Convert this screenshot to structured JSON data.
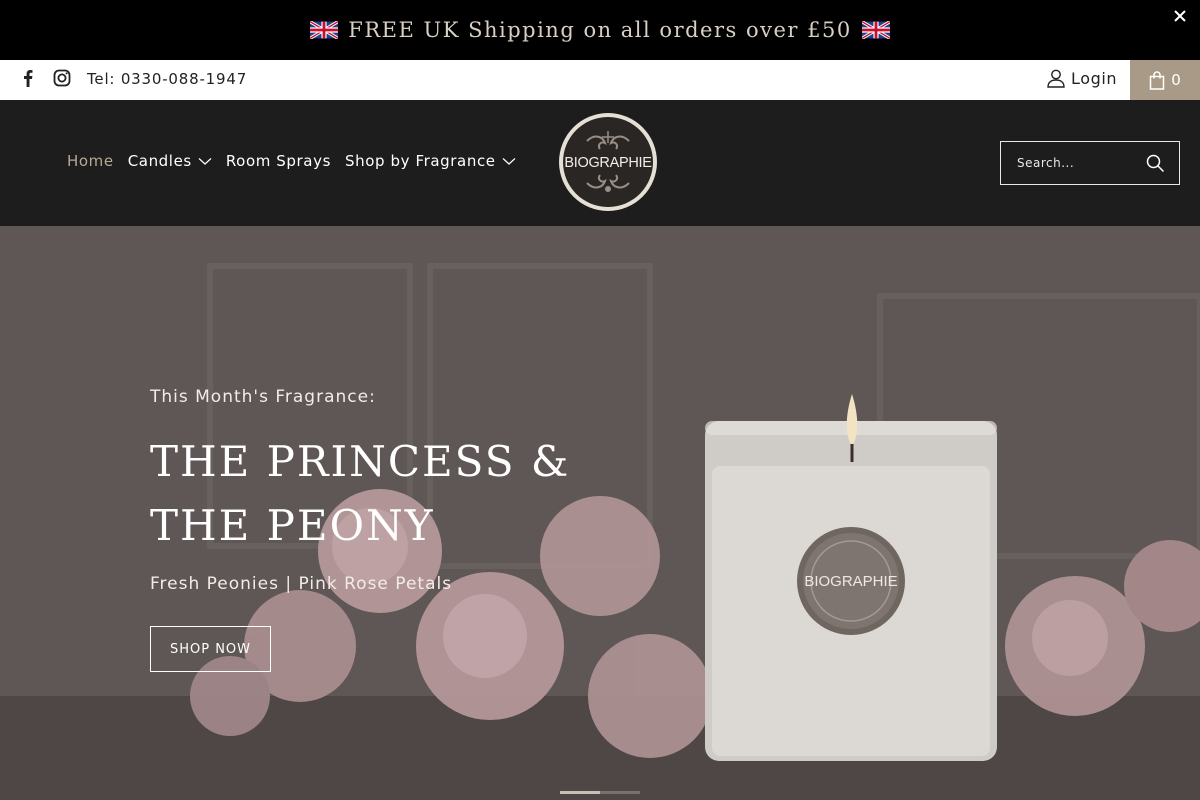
{
  "announcement": {
    "text": "FREE UK Shipping on all orders over £50",
    "flag_icon": "uk-flag-icon",
    "close_icon": "close-icon"
  },
  "topbar": {
    "social": [
      {
        "name": "facebook-icon"
      },
      {
        "name": "instagram-icon"
      }
    ],
    "phone": "Tel: 0330-088-1947",
    "login_label": "Login",
    "cart_count": "0"
  },
  "nav": {
    "items": [
      {
        "label": "Home",
        "active": true,
        "dropdown": false
      },
      {
        "label": "Candles",
        "active": false,
        "dropdown": true
      },
      {
        "label": "Room Sprays",
        "active": false,
        "dropdown": false
      },
      {
        "label": "Shop by Fragrance",
        "active": false,
        "dropdown": true
      }
    ]
  },
  "logo": {
    "text": "BIOGRAPHIE"
  },
  "search": {
    "placeholder": "Search..."
  },
  "hero": {
    "eyebrow": "This Month's Fragrance:",
    "title": "THE PRINCESS & THE PEONY",
    "subtitle": "Fresh Peonies | Pink Rose Petals",
    "cta": "SHOP NOW",
    "candle_label": "BIOGRAPHIE",
    "slides": 2,
    "active_slide": 1
  },
  "colors": {
    "announce_bg": "#000000",
    "header_bg": "#1d1d1d",
    "accent": "#a89a86",
    "active_nav": "#b6a995"
  }
}
